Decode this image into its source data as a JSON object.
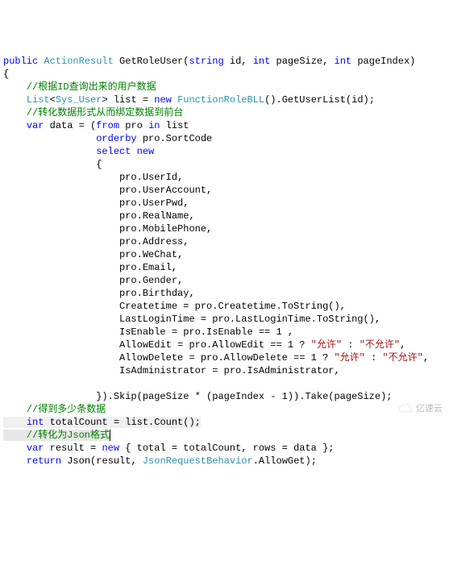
{
  "code": {
    "sig_public": "public",
    "sig_ret": "ActionResult",
    "sig_name": " GetRoleUser(",
    "sig_p1t": "string",
    "sig_p1n": " id, ",
    "sig_p2t": "int",
    "sig_p2n": " pageSize, ",
    "sig_p3t": "int",
    "sig_p3n": " pageIndex)",
    "open_brace": "{",
    "c1": "    //根据ID查询出来的用户数据",
    "l2a": "List",
    "l2b": "<",
    "l2c": "Sys_User",
    "l2d": "> list = ",
    "l2e": "new",
    "l2f": " ",
    "l2g": "FunctionRoleBLL",
    "l2h": "().GetUserList(id);",
    "c2": "    //转化数据形式从而绑定数据到前台",
    "l3a": "var",
    "l3b": " data = (",
    "l3c": "from",
    "l3d": " pro ",
    "l3e": "in",
    "l3f": " list",
    "l4a": "                ",
    "l4b": "orderby",
    "l4c": " pro.SortCode",
    "l5a": "                ",
    "l5b": "select",
    "l5c": " ",
    "l5d": "new",
    "l6": "                {",
    "p1": "                    pro.UserId,",
    "p2": "                    pro.UserAccount,",
    "p3": "                    pro.UserPwd,",
    "p4": "                    pro.RealName,",
    "p5": "                    pro.MobilePhone,",
    "p6": "                    pro.Address,",
    "p7": "                    pro.WeChat,",
    "p8": "                    pro.Email,",
    "p9": "                    pro.Gender,",
    "p10": "                    pro.Birthday,",
    "p11": "                    Createtime = pro.Createtime.ToString(),",
    "p12": "                    LastLoginTime = pro.LastLoginTime.ToString(),",
    "p13": "                    IsEnable = pro.IsEnable == 1 ,",
    "p14a": "                    AllowEdit = pro.AllowEdit == 1 ? ",
    "p14s1": "\"允许\"",
    "p14b": " : ",
    "p14s2": "\"不允许\"",
    "p14c": ",",
    "p15a": "                    AllowDelete = pro.AllowDelete == 1 ? ",
    "p15s1": "\"允许\"",
    "p15b": " : ",
    "p15s2": "\"不允许\"",
    "p15c": ",",
    "p16": "                    IsAdministrator = pro.IsAdministrator,",
    "blank": "",
    "l7": "                }).Skip(pageSize * (pageIndex - 1)).Take(pageSize);",
    "c3": "    //得到多少条数据",
    "l8a": "int",
    "l8b": " totalCount = list.Count();",
    "c4": "    //转化为Json格式",
    "l9a": "var",
    "l9b": " result = ",
    "l9c": "new",
    "l9d": " { total = totalCount, rows = data };",
    "l10a": "return",
    "l10b": " Json(result, ",
    "l10c": "JsonRequestBehavior",
    "l10d": ".AllowGet);"
  },
  "watermark": "亿速云"
}
